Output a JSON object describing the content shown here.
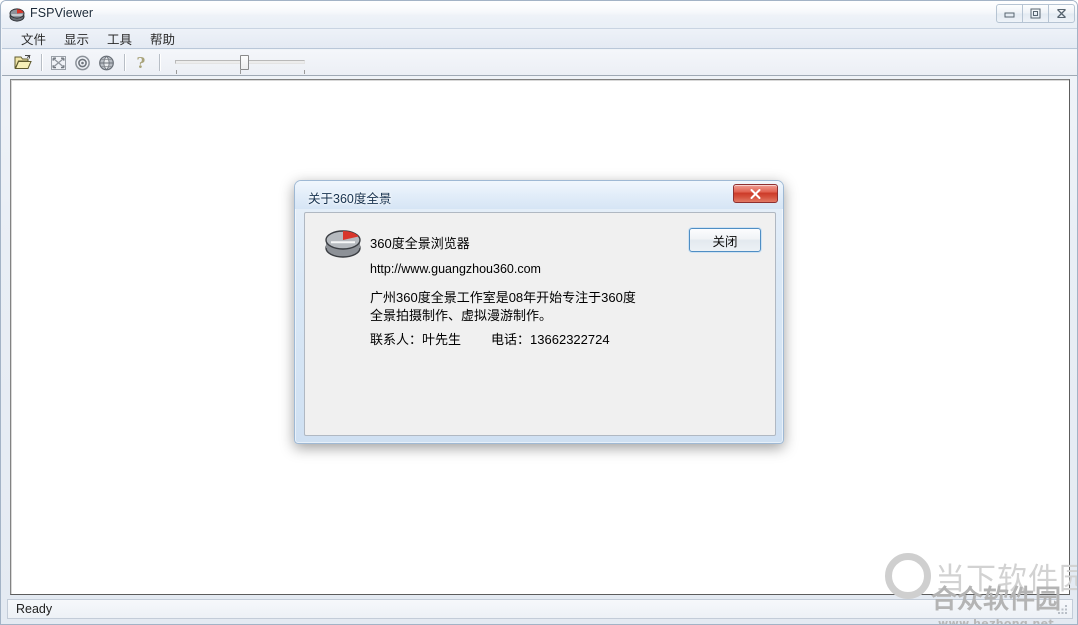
{
  "window": {
    "title": "FSPViewer",
    "icon": "panorama-disc-icon",
    "buttons": {
      "minimize": "minimize-icon",
      "maximize": "maximize-icon",
      "close": "close-icon"
    }
  },
  "menu": {
    "items": [
      {
        "label": "文件",
        "name": "menu-file"
      },
      {
        "label": "显示",
        "name": "menu-view"
      },
      {
        "label": "工具",
        "name": "menu-tools"
      },
      {
        "label": "帮助",
        "name": "menu-help"
      }
    ]
  },
  "toolbar": {
    "buttons": [
      {
        "name": "open-file-icon",
        "title": "打开"
      },
      {
        "name": "fullscreen-icon",
        "title": "全屏"
      },
      {
        "name": "target-icon",
        "title": "中心"
      },
      {
        "name": "globe-icon",
        "title": "全景"
      },
      {
        "name": "help-icon",
        "title": "帮助"
      }
    ],
    "slider": {
      "name": "zoom-slider",
      "value": 50,
      "min": 0,
      "max": 100
    }
  },
  "status": {
    "text": "Ready"
  },
  "dialog": {
    "title": "关于360度全景",
    "icon": "panorama-disc-icon",
    "app_name": "360度全景浏览器",
    "url": "http://www.guangzhou360.com",
    "description": "广州360度全景工作室是08年开始专注于360度\n全景拍摄制作、虚拟漫游制作。",
    "contact_label": "联系人：",
    "contact_name": "叶先生",
    "phone_label": "电话：",
    "phone_number": "13662322724",
    "ok_button": "关闭",
    "close_button": "close-icon"
  },
  "watermarks": {
    "one": {
      "text": "当下软件园",
      "logo": "o-ring-logo"
    },
    "two": {
      "text": "合众软件园",
      "url": "www.hezhong.net"
    }
  },
  "colors": {
    "accent_blue": "#4f8ec4",
    "close_red": "#cc3a28",
    "window_bg": "#e4eaf2",
    "dialog_body": "#f0f0f0"
  }
}
